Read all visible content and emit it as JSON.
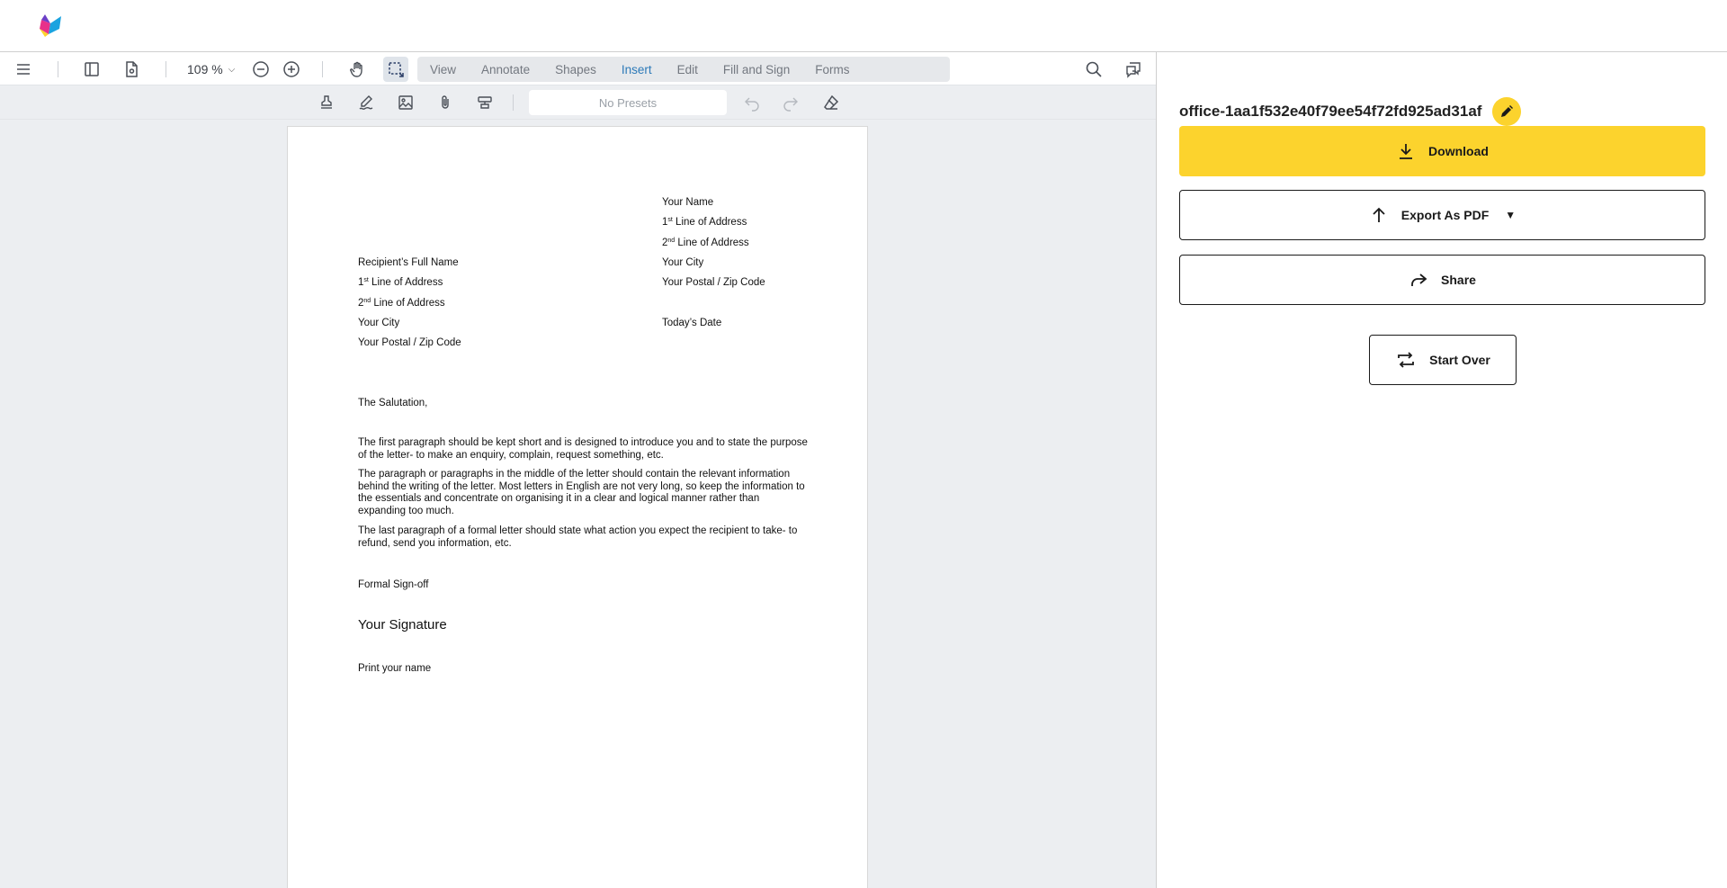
{
  "colors": {
    "accent": "#fcd32d",
    "active_tab": "#2d7ab8"
  },
  "toolbar": {
    "zoom_value": "109 %",
    "tabs": [
      "View",
      "Annotate",
      "Shapes",
      "Insert",
      "Edit",
      "Fill and Sign",
      "Forms"
    ],
    "active_tab": "Insert",
    "presets_placeholder": "No Presets"
  },
  "letter": {
    "sender": {
      "name": "Your Name",
      "line1_pre": "1",
      "line1_sup": "st",
      "line1_post": " Line of Address",
      "line2_pre": "2",
      "line2_sup": "nd",
      "line2_post": " Line of Address",
      "city": "Your City",
      "postal": "Your Postal / Zip Code",
      "date": "Today’s Date"
    },
    "recipient": {
      "name": "Recipient’s Full Name",
      "line1_pre": "1",
      "line1_sup": "st",
      "line1_post": " Line of Address",
      "line2_pre": "2",
      "line2_sup": "nd",
      "line2_post": " Line of Address",
      "city": "Your City",
      "postal": "Your Postal / Zip Code"
    },
    "salutation": "The Salutation,",
    "paragraphs": [
      "The first paragraph should be kept short and is designed to introduce you and to state the purpose of the letter- to make an enquiry, complain, request something, etc.",
      "The paragraph or paragraphs in the middle of the letter should contain the relevant information behind the writing of the letter. Most letters in English are not very long, so keep the information to the essentials and concentrate on organising it in a clear and logical manner rather than expanding too much.",
      "The last paragraph of a formal letter should state what action you expect the recipient to take- to refund, send you information, etc."
    ],
    "signoff": "Formal Sign-off",
    "signature": "Your Signature",
    "print_name": "Print your name"
  },
  "panel": {
    "file_name": "office-1aa1f532e40f79ee54f72fd925ad31af",
    "download_label": "Download",
    "export_label": "Export As PDF",
    "share_label": "Share",
    "start_over_label": "Start Over"
  }
}
